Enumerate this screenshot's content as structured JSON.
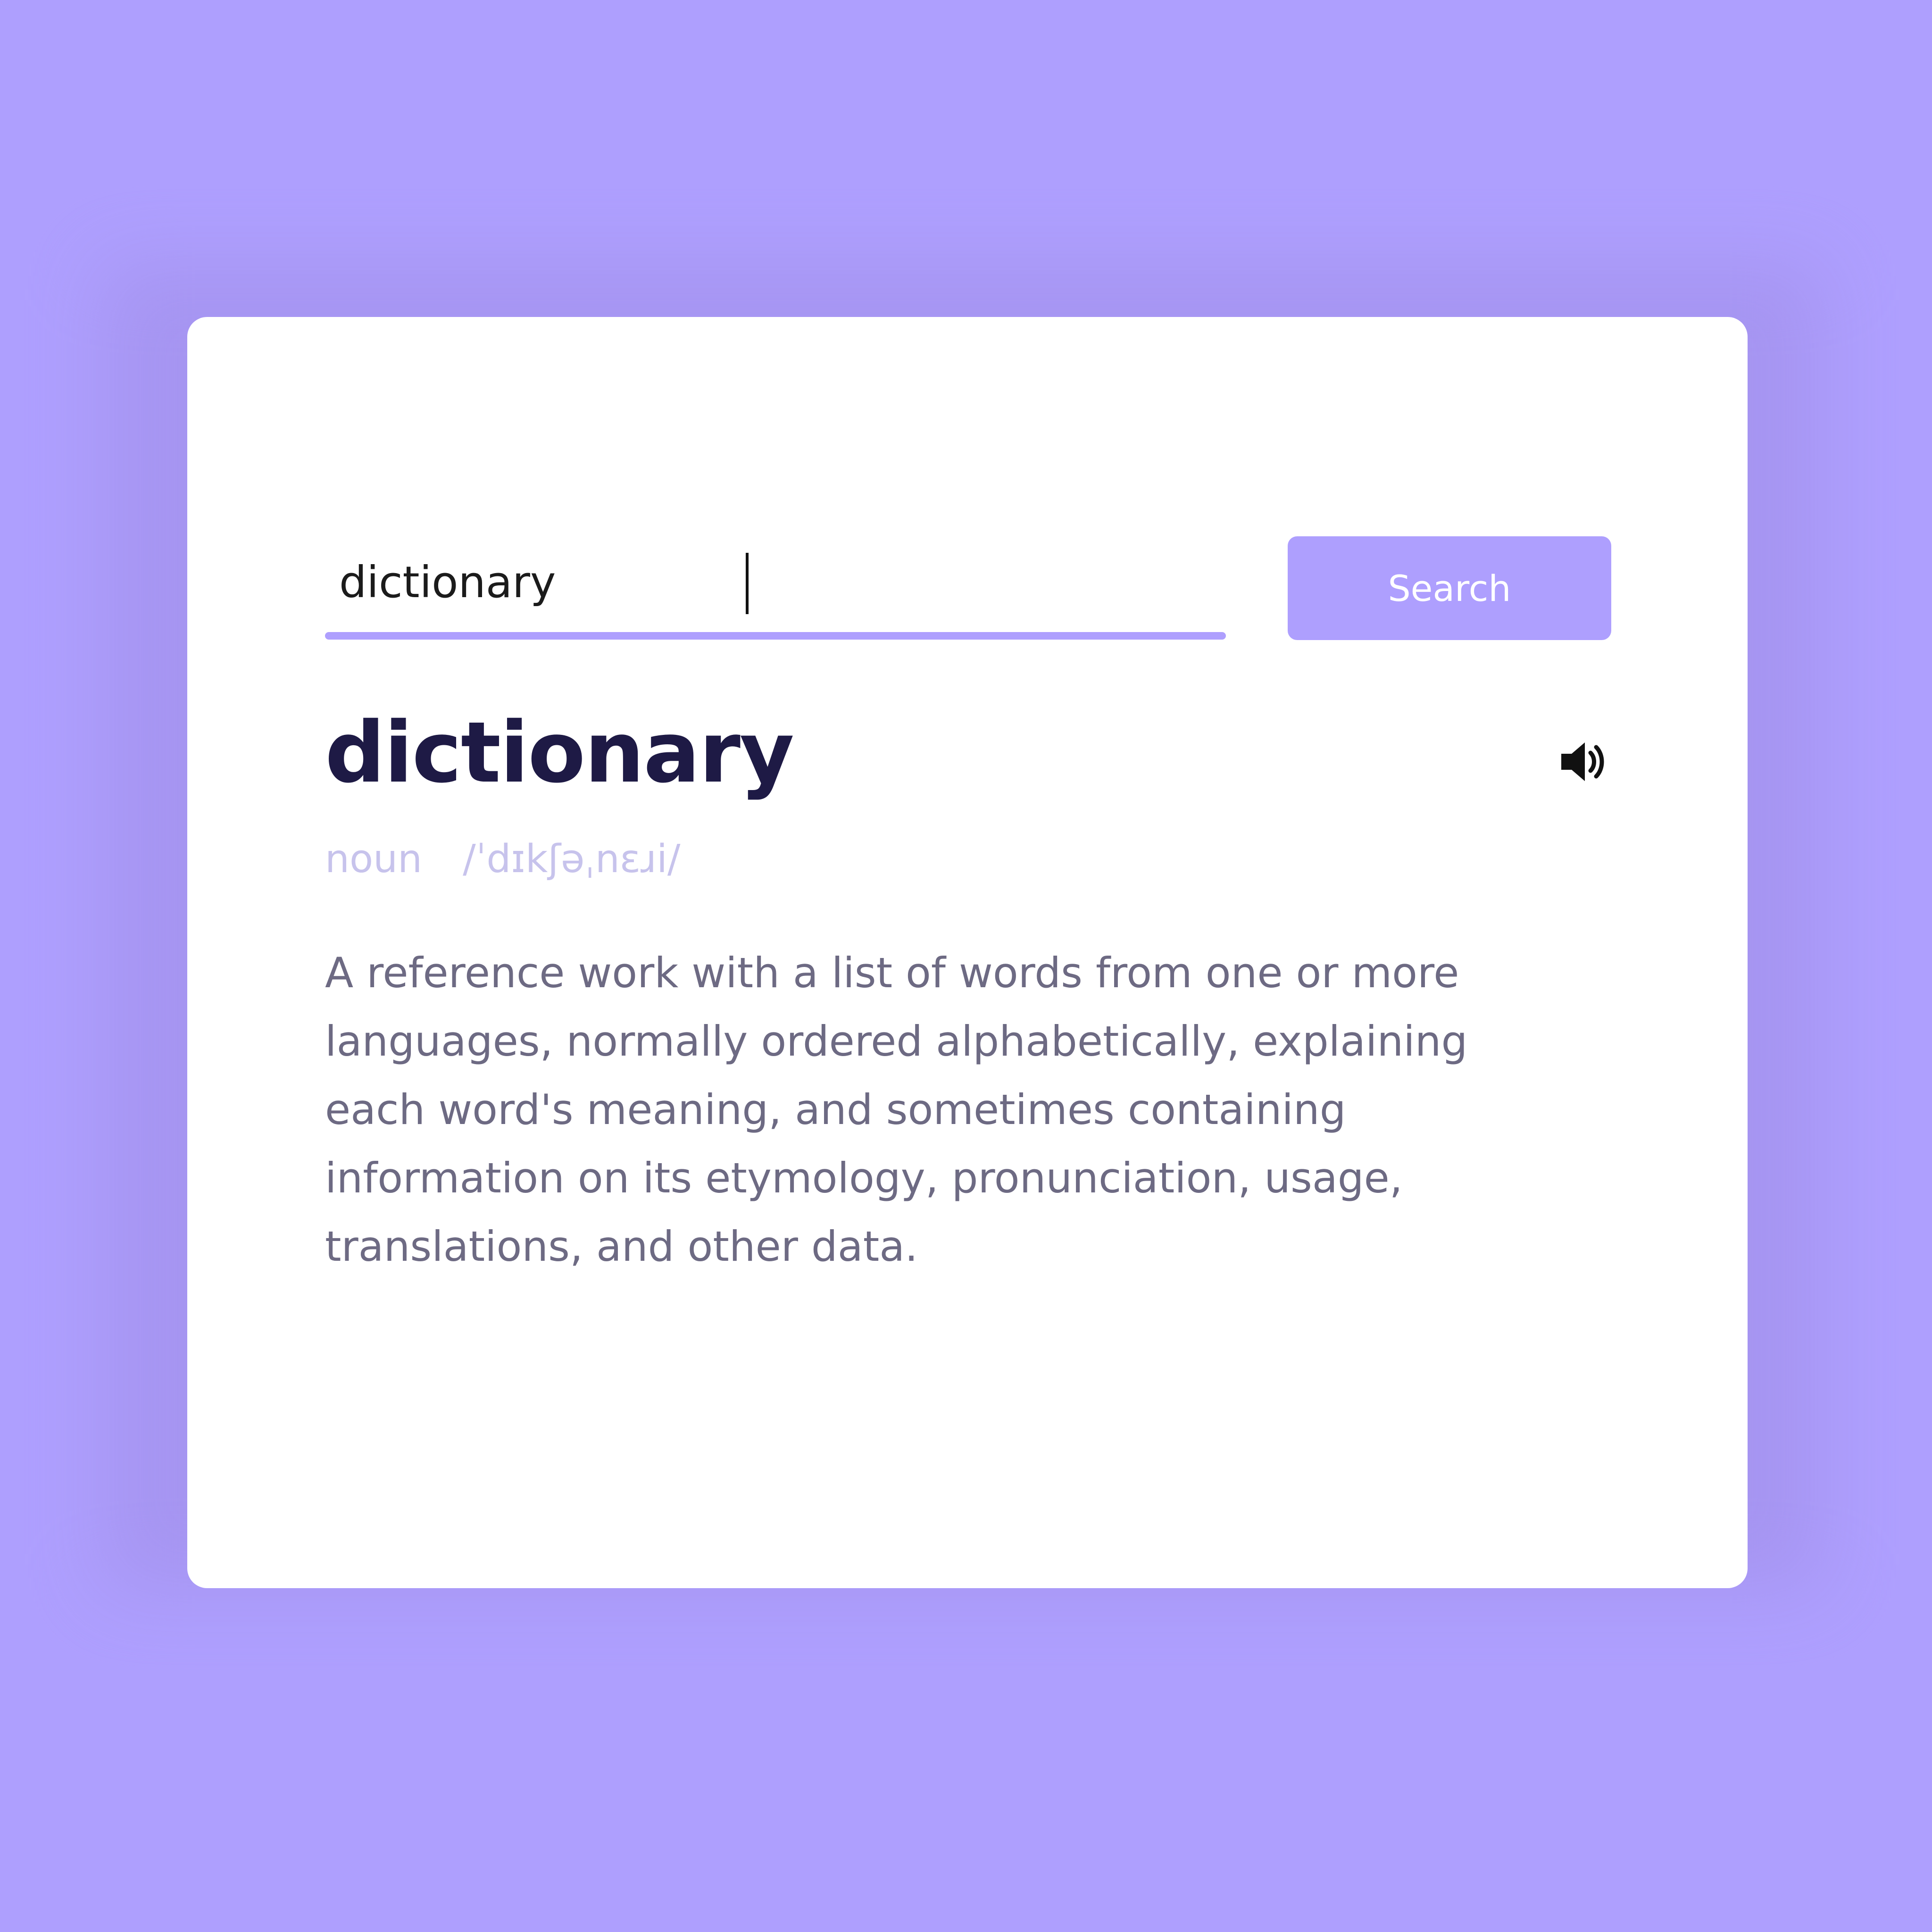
{
  "search": {
    "value": "dictionary",
    "button_label": "Search"
  },
  "entry": {
    "word": "dictionary",
    "part_of_speech": "noun",
    "phonetic": "/ˈdɪkʃəˌnɛɹi/",
    "definition": "A reference work with a list of words from one or more languages, normally ordered alphabetically, explaining each word's meaning, and sometimes containing information on its etymology, pronunciation, usage, translations, and other data."
  },
  "icons": {
    "audio": "speaker-icon"
  },
  "colors": {
    "background": "#ae9ffe",
    "accent": "#ae9ffe",
    "card": "#ffffff",
    "heading": "#1e1a45",
    "muted": "#c7c3ec",
    "body_text": "#6d6a83"
  }
}
